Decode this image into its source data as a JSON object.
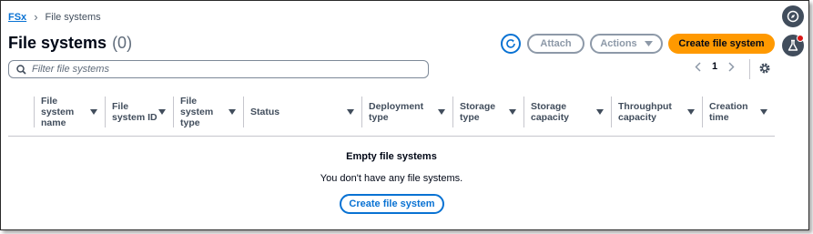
{
  "breadcrumb": {
    "root": "FSx",
    "current": "File systems"
  },
  "header": {
    "title": "File systems",
    "count": "(0)",
    "attach_label": "Attach",
    "actions_label": "Actions",
    "create_label": "Create file system"
  },
  "search": {
    "placeholder": "Filter file systems",
    "value": ""
  },
  "pagination": {
    "current_page": "1"
  },
  "table": {
    "columns": [
      "File system name",
      "File system ID",
      "File system type",
      "Status",
      "Deployment type",
      "Storage type",
      "Storage capacity",
      "Throughput capacity",
      "Creation time"
    ]
  },
  "empty_state": {
    "title": "Empty file systems",
    "message": "You don't have any file systems.",
    "button_label": "Create file system"
  },
  "colors": {
    "primary_button": "#ff9900",
    "link": "#0972d3",
    "disabled": "#8d99a8",
    "notification": "#d91515"
  },
  "icons": [
    "refresh-icon",
    "caret-down-icon",
    "search-icon",
    "chevron-left-icon",
    "chevron-right-icon",
    "settings-icon",
    "compass-icon",
    "flask-icon"
  ]
}
